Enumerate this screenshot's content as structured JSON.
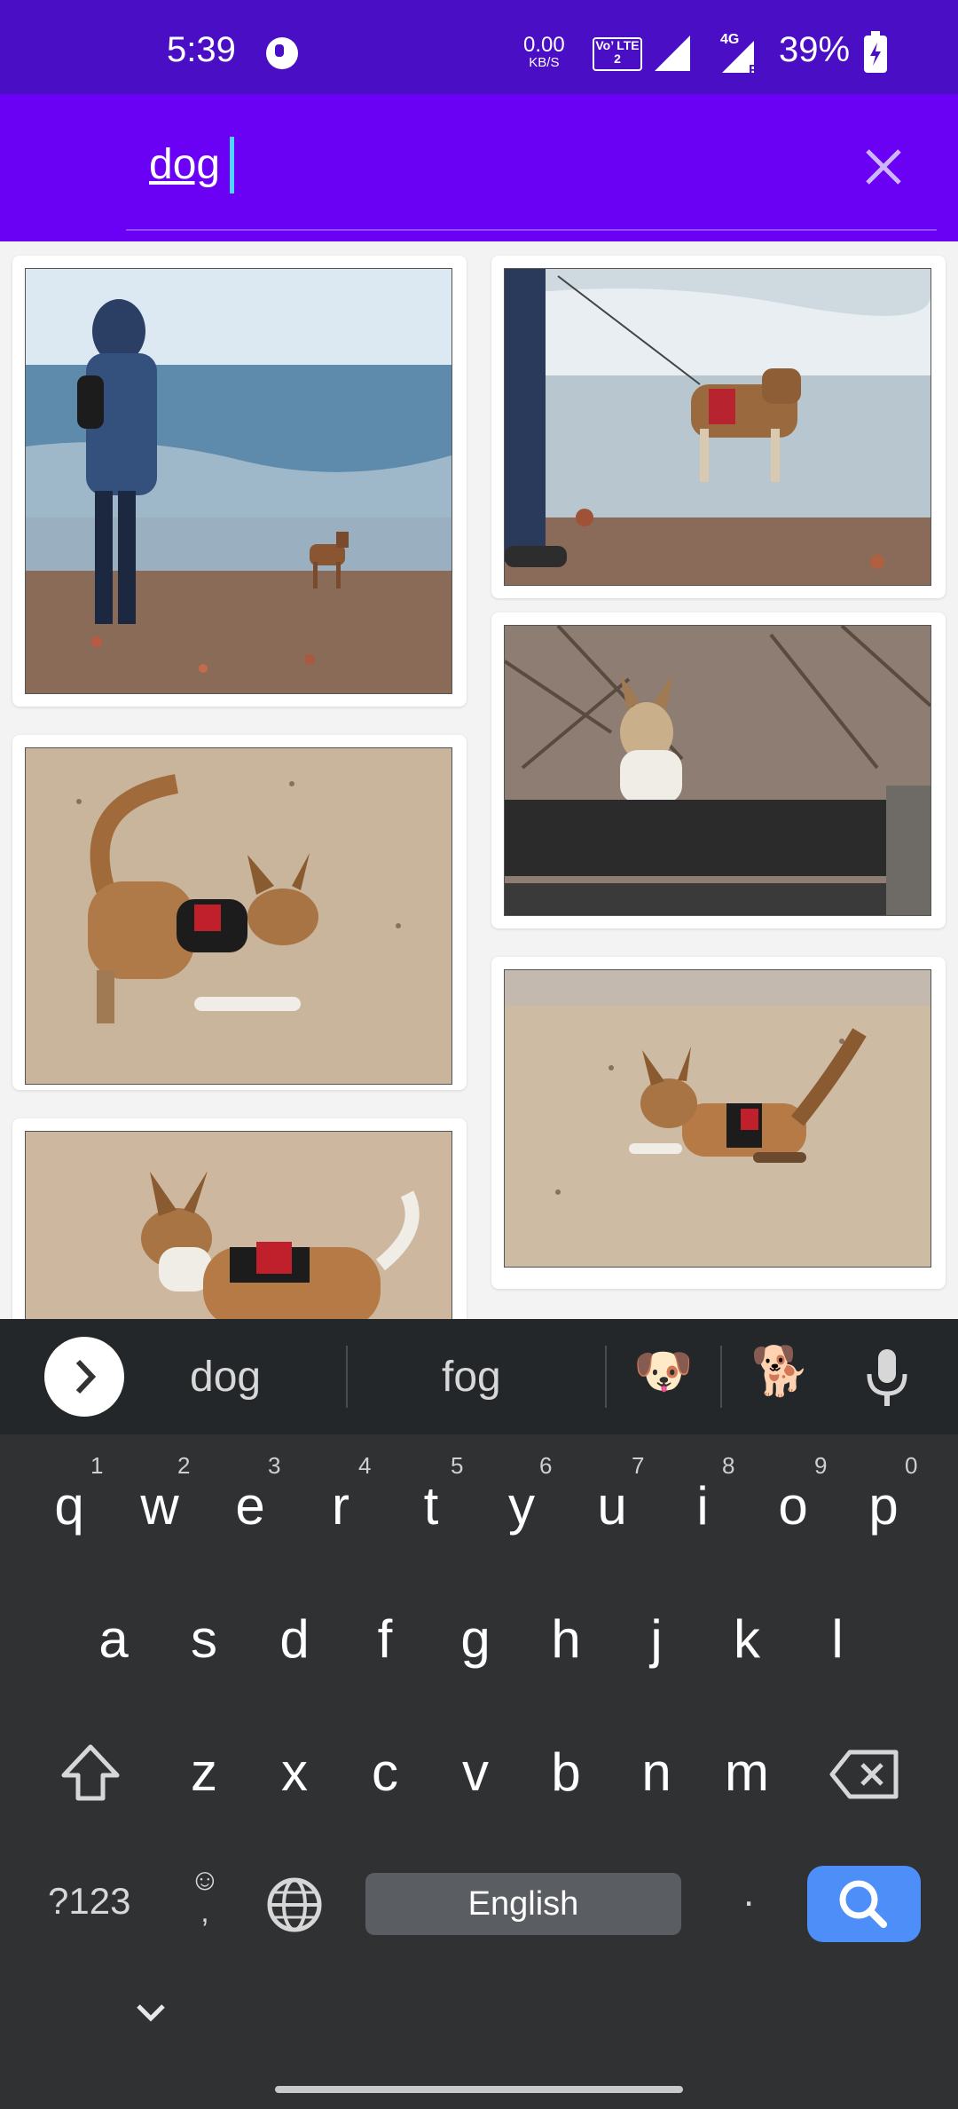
{
  "status_bar": {
    "time": "5:39",
    "net_speed_value": "0.00",
    "net_speed_unit": "KB/S",
    "volte_label": "Vo’ LTE 2",
    "network_type": "4G",
    "network_sub": "R",
    "battery_percent": "39%"
  },
  "search": {
    "query": "dog",
    "clear_icon": "close-icon"
  },
  "results": {
    "images": [
      {
        "subject": "person and dog at beach shoreline"
      },
      {
        "subject": "dog on leash on beach"
      },
      {
        "subject": "dog sitting behind wooden plank"
      },
      {
        "subject": "dog playing bow on sand"
      },
      {
        "subject": "dog running on sand"
      },
      {
        "subject": "dog lying on sand"
      }
    ]
  },
  "keyboard": {
    "suggestions": [
      "dog",
      "fog"
    ],
    "emoji_suggestions": [
      "🐶",
      "🐕"
    ],
    "row1": [
      "q",
      "w",
      "e",
      "r",
      "t",
      "y",
      "u",
      "i",
      "o",
      "p"
    ],
    "row1_numbers": [
      "1",
      "2",
      "3",
      "4",
      "5",
      "6",
      "7",
      "8",
      "9",
      "0"
    ],
    "row2": [
      "a",
      "s",
      "d",
      "f",
      "g",
      "h",
      "j",
      "k",
      "l"
    ],
    "row3": [
      "z",
      "x",
      "c",
      "v",
      "b",
      "n",
      "m"
    ],
    "symbols_key": "?123",
    "emoji_comma_top": "☺",
    "emoji_comma_bottom": ",",
    "space_label": "English",
    "period_key": "."
  }
}
